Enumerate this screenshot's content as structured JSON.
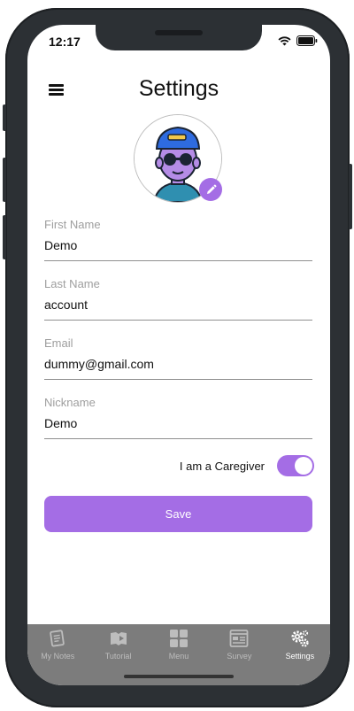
{
  "status_bar": {
    "time": "12:17"
  },
  "header": {
    "title": "Settings"
  },
  "profile": {
    "avatar_alt": "user avatar"
  },
  "form": {
    "fields": [
      {
        "label": "First Name",
        "value": "Demo"
      },
      {
        "label": "Last Name",
        "value": "account"
      },
      {
        "label": "Email",
        "value": "dummy@gmail.com"
      },
      {
        "label": "Nickname",
        "value": "Demo"
      }
    ],
    "caregiver_label": "I am a Caregiver",
    "caregiver_on": true,
    "save_label": "Save"
  },
  "tabs": [
    {
      "label": "My Notes",
      "icon": "notes-icon"
    },
    {
      "label": "Tutorial",
      "icon": "book-play-icon"
    },
    {
      "label": "Menu",
      "icon": "grid-icon"
    },
    {
      "label": "Survey",
      "icon": "survey-icon"
    },
    {
      "label": "Settings",
      "icon": "gears-icon",
      "active": true
    }
  ],
  "colors": {
    "accent": "#a46de5",
    "tabbar": "#7c7c7c",
    "label": "#9e9e9e"
  }
}
